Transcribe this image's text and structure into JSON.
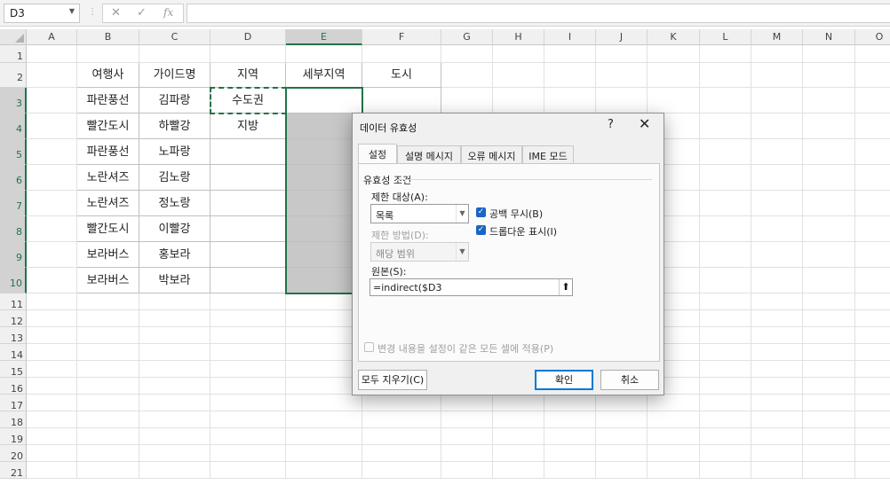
{
  "formula_bar": {
    "name_box": "D3",
    "cancel_glyph": "✕",
    "enter_glyph": "✓",
    "fx_glyph": "fx",
    "content": ""
  },
  "sheet": {
    "columns": [
      "A",
      "B",
      "C",
      "D",
      "E",
      "F",
      "G",
      "H",
      "I",
      "J",
      "K",
      "L",
      "M",
      "N",
      "O"
    ],
    "rows": [
      "1",
      "2",
      "3",
      "4",
      "5",
      "6",
      "7",
      "8",
      "9",
      "10",
      "11",
      "12",
      "13",
      "14",
      "15",
      "16",
      "17",
      "18",
      "19",
      "20",
      "21"
    ],
    "selected_column": "E",
    "table": {
      "headers": [
        "여행사",
        "가이드명",
        "지역",
        "세부지역",
        "도시"
      ],
      "rows": [
        [
          "파란풍선",
          "김파랑",
          "수도권",
          "",
          ""
        ],
        [
          "빨간도시",
          "하빨강",
          "지방",
          "",
          ""
        ],
        [
          "파란풍선",
          "노파랑",
          "",
          "",
          ""
        ],
        [
          "노란셔즈",
          "김노랑",
          "",
          "",
          ""
        ],
        [
          "노란셔즈",
          "정노랑",
          "",
          "",
          ""
        ],
        [
          "빨간도시",
          "이빨강",
          "",
          "",
          ""
        ],
        [
          "보라버스",
          "홍보라",
          "",
          "",
          ""
        ],
        [
          "보라버스",
          "박보라",
          "",
          "",
          ""
        ]
      ]
    }
  },
  "dialog": {
    "title": "데이터 유효성",
    "help": "?",
    "close": "✕",
    "tabs": [
      "설정",
      "설명 메시지",
      "오류 메시지",
      "IME 모드"
    ],
    "group_label": "유효성 조건",
    "allow_label": "제한 대상(A):",
    "allow_value": "목록",
    "ignore_blank_label": "공백 무시(B)",
    "ignore_blank": true,
    "in_cell_dropdown_label": "드롭다운 표시(I)",
    "in_cell_dropdown": true,
    "data_label": "제한 방법(D):",
    "data_value": "해당 범위",
    "source_label": "원본(S):",
    "source_value": "=indirect($D3",
    "apply_all_label": "변경 내용을 설정이 같은 모든 셀에 적용(P)",
    "apply_all": false,
    "clear_all_button": "모두 지우기(C)",
    "ok_button": "확인",
    "cancel_button": "취소"
  }
}
